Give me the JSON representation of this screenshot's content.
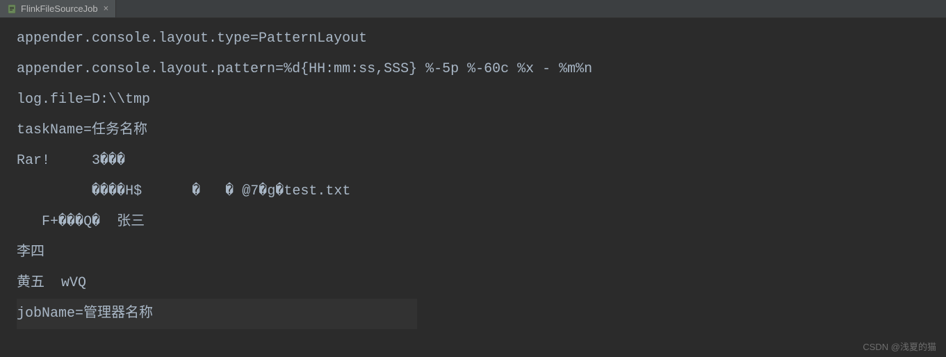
{
  "tab": {
    "label": "FlinkFileSourceJob",
    "close": "×"
  },
  "editor": {
    "lines": [
      "appender.console.layout.type=PatternLayout",
      "appender.console.layout.pattern=%d{HH:mm:ss,SSS} %-5p %-60c %x - %m%n",
      "log.file=D:\\\\tmp",
      "taskName=任务名称",
      "Rar!     3���",
      "         ����H$      �   � @7�g�test.txt",
      "   F+���Q�  张三",
      "李四",
      "黄五  wVQ",
      "jobName=管理器名称"
    ]
  },
  "watermark": "CSDN @浅夏的猫"
}
